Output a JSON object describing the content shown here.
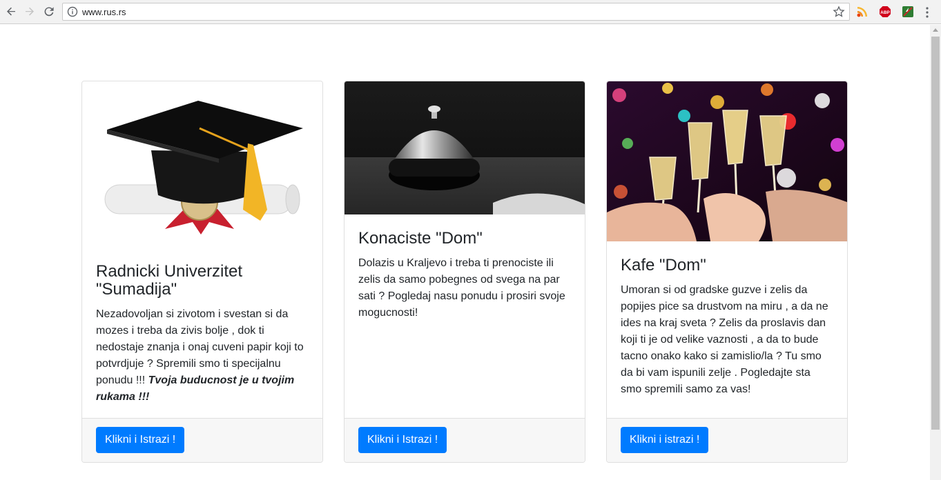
{
  "browser": {
    "url": "www.rus.rs",
    "extensions": [
      "feed-extension-icon",
      "adblock-extension-icon",
      "flash-extension-icon"
    ]
  },
  "cards": [
    {
      "title": "Radnicki Univerzitet \"Sumadija\"",
      "text": "Nezadovoljan si zivotom i svestan si da mozes i treba da zivis bolje , dok ti nedostaje znanja i onaj cuveni papir koji to potvrdjuje ? Spremili smo ti specijalnu ponudu !!! ",
      "emphasis": "Tvoja buducnost je u tvojim rukama !!!",
      "button": "Klikni i Istrazi !"
    },
    {
      "title": "Konaciste \"Dom\"",
      "text": "Dolazis u Kraljevo i treba ti prenociste ili zelis da samo pobegnes od svega na par sati ? Pogledaj nasu ponudu i prosiri svoje mogucnosti!",
      "button": "Klikni i Istrazi !"
    },
    {
      "title": "Kafe \"Dom\"",
      "text": "Umoran si od gradske guzve i zelis da popijes pice sa drustvom na miru , a da ne ides na kraj sveta ? Zelis da proslavis dan koji ti je od velike vaznosti , a da to bude tacno onako kako si zamislio/la ? Tu smo da bi vam ispunili zelje . Pogledajte sta smo spremili samo za vas!",
      "button": "Klikni i istrazi !"
    }
  ],
  "colors": {
    "primary": "#007bff",
    "footer_bg": "#f7f7f7",
    "card_border": "#dfdfdf"
  }
}
